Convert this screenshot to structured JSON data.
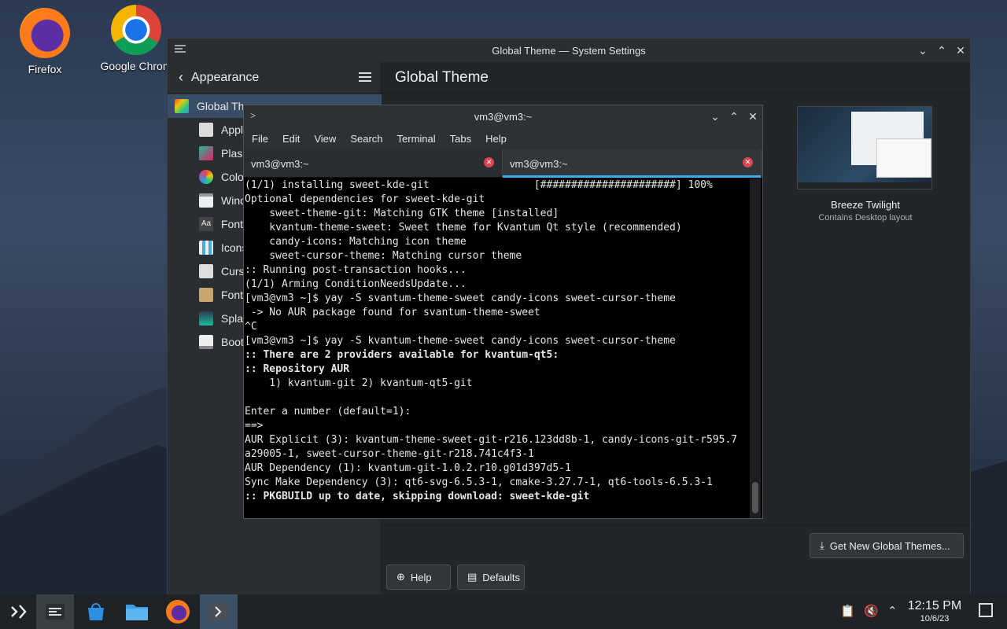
{
  "desktop": {
    "icons": [
      {
        "label": "Firefox"
      },
      {
        "label": "Google Chrom"
      }
    ]
  },
  "settings": {
    "window_title": "Global Theme — System Settings",
    "back_label": "Appearance",
    "page_title": "Global Theme",
    "sidebar": [
      {
        "label": "Global Th",
        "icon": "global-theme-icon",
        "active": true
      },
      {
        "label": "Appl",
        "icon": "application-style-icon"
      },
      {
        "label": "Plasr",
        "icon": "plasma-style-icon"
      },
      {
        "label": "Colo",
        "icon": "colors-icon"
      },
      {
        "label": "Windo",
        "icon": "window-decorations-icon"
      },
      {
        "label": "Fonts",
        "icon": "fonts-icon"
      },
      {
        "label": "Icons",
        "icon": "icons-icon"
      },
      {
        "label": "Curs",
        "icon": "cursors-icon"
      },
      {
        "label": "Font",
        "icon": "font-management-icon"
      },
      {
        "label": "Splas",
        "icon": "splash-screen-icon"
      },
      {
        "label": "Boot",
        "icon": "boot-splash-icon"
      }
    ],
    "theme_card": {
      "name": "Breeze Twilight",
      "subtitle": "Contains Desktop layout"
    },
    "get_new_button": "Get New Global Themes...",
    "help_button": "Help",
    "defaults_button": "Defaults"
  },
  "terminal": {
    "title": "vm3@vm3:~",
    "menu": [
      "File",
      "Edit",
      "View",
      "Search",
      "Terminal",
      "Tabs",
      "Help"
    ],
    "tabs": [
      {
        "label": "vm3@vm3:~",
        "active": false
      },
      {
        "label": "vm3@vm3:~",
        "active": true
      }
    ],
    "lines": [
      {
        "text": "(1/1) installing sweet-kde-git                 [######################] 100%",
        "bold": false
      },
      {
        "text": "Optional dependencies for sweet-kde-git",
        "bold": false
      },
      {
        "text": "    sweet-theme-git: Matching GTK theme [installed]",
        "bold": false
      },
      {
        "text": "    kvantum-theme-sweet: Sweet theme for Kvantum Qt style (recommended)",
        "bold": false
      },
      {
        "text": "    candy-icons: Matching icon theme",
        "bold": false
      },
      {
        "text": "    sweet-cursor-theme: Matching cursor theme",
        "bold": false
      },
      {
        "text": ":: Running post-transaction hooks...",
        "bold": false
      },
      {
        "text": "(1/1) Arming ConditionNeedsUpdate...",
        "bold": false
      },
      {
        "text": "[vm3@vm3 ~]$ yay -S svantum-theme-sweet candy-icons sweet-cursor-theme",
        "bold": false
      },
      {
        "text": " -> No AUR package found for svantum-theme-sweet",
        "bold": false
      },
      {
        "text": "^C",
        "bold": false
      },
      {
        "text": "[vm3@vm3 ~]$ yay -S kvantum-theme-sweet candy-icons sweet-cursor-theme",
        "bold": false
      },
      {
        "text": ":: There are 2 providers available for kvantum-qt5:",
        "bold": true
      },
      {
        "text": ":: Repository AUR",
        "bold": true
      },
      {
        "text": "    1) kvantum-git 2) kvantum-qt5-git",
        "bold": false
      },
      {
        "text": "",
        "bold": false
      },
      {
        "text": "Enter a number (default=1):",
        "bold": false
      },
      {
        "text": "==>",
        "bold": false
      },
      {
        "text": "AUR Explicit (3): kvantum-theme-sweet-git-r216.123dd8b-1, candy-icons-git-r595.7",
        "bold": false
      },
      {
        "text": "a29005-1, sweet-cursor-theme-git-r218.741c4f3-1",
        "bold": false
      },
      {
        "text": "AUR Dependency (1): kvantum-git-1.0.2.r10.g01d397d5-1",
        "bold": false
      },
      {
        "text": "Sync Make Dependency (3): qt6-svg-6.5.3-1, cmake-3.27.7-1, qt6-tools-6.5.3-1",
        "bold": false
      },
      {
        "text": ":: PKGBUILD up to date, skipping download: sweet-kde-git",
        "bold": true
      }
    ]
  },
  "taskbar": {
    "clock_time": "12:15 PM",
    "clock_date": "10/6/23"
  }
}
